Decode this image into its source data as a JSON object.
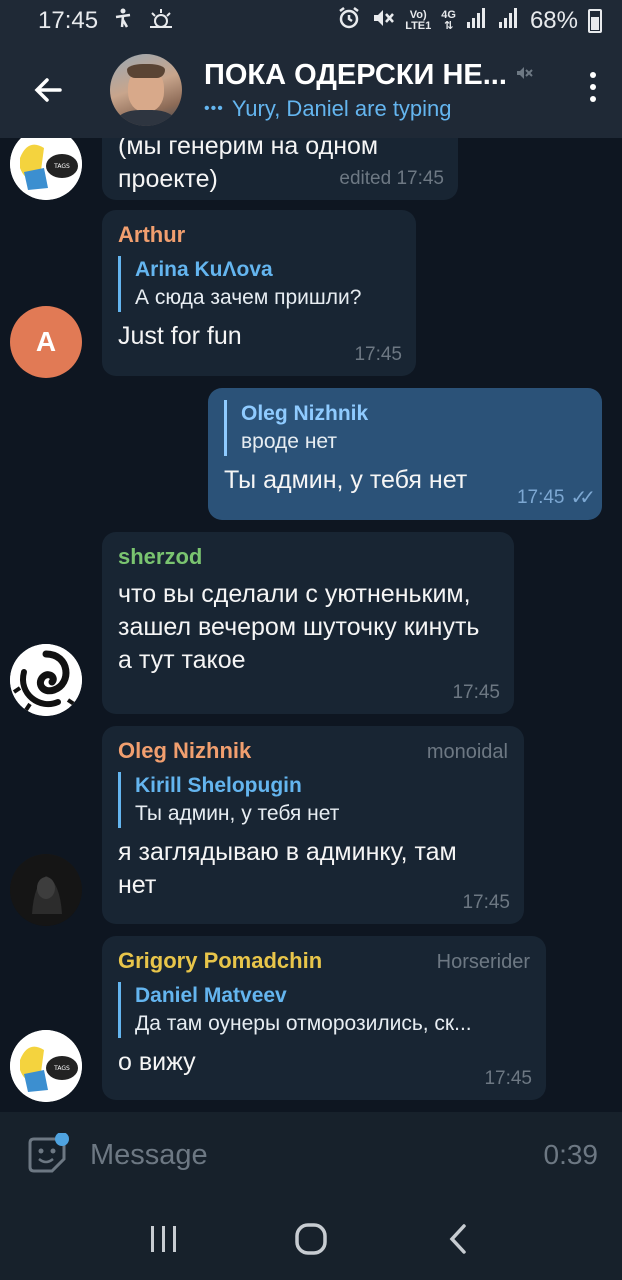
{
  "status_bar": {
    "time": "17:45",
    "network_top": "Vo)",
    "network_bottom": "LTE1",
    "network_gen": "4G",
    "battery": "68%"
  },
  "header": {
    "title": "ПОКА ОДЕРСКИ НЕ...",
    "typing": "Yury, Daniel are typing",
    "muted": true
  },
  "messages": [
    {
      "text": "(мы генерим на одном\nпроекте)",
      "time": "edited 17:45"
    },
    {
      "sender": "Arthur",
      "sender_color": "#f19f6f",
      "avatar_letter": "A",
      "reply_name": "Arina KuΛova",
      "reply_text": "А сюда зачем пришли?",
      "text": "Just for fun",
      "time": "17:45"
    },
    {
      "outgoing": true,
      "reply_name": "Oleg Nizhnik",
      "reply_text": "вроде нет",
      "text": "Ты админ, у тебя нет",
      "time": "17:45"
    },
    {
      "sender": "sherzod",
      "sender_color": "#7ac470",
      "text": "что вы сделали с уютненьким, зашел вечером шуточку кинуть а тут такое",
      "time": "17:45"
    },
    {
      "sender": "Oleg Nizhnik",
      "sender_color": "#f19f6f",
      "role": "monoidal",
      "reply_name": "Kirill Shelopugin",
      "reply_text": "Ты админ, у тебя нет",
      "text": "я заглядываю в админку, там нет",
      "time": "17:45"
    },
    {
      "sender": "Grigory Pomadchin",
      "sender_color": "#e8c54a",
      "role": "Horserider",
      "reply_name": "Daniel Matveev",
      "reply_text": "Да там оунеры отморозились, ск...",
      "text": "о вижу",
      "time": "17:45"
    }
  ],
  "input": {
    "placeholder": "Message",
    "record_time": "0:39"
  }
}
